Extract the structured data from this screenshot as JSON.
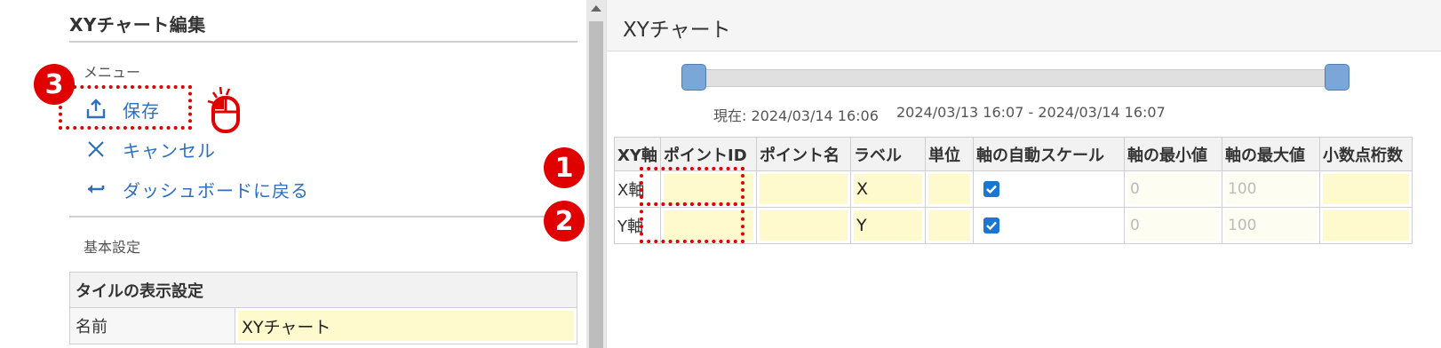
{
  "left": {
    "title": "XYチャート編集",
    "menu_label": "メニュー",
    "menu": [
      {
        "label": "保存",
        "icon": "upload-icon"
      },
      {
        "label": "キャンセル",
        "icon": "close-icon"
      },
      {
        "label": "ダッシュボードに戻る",
        "icon": "back-arrow-icon"
      }
    ],
    "basic_label": "基本設定",
    "tile_header": "タイルの表示設定",
    "tile_rows": [
      {
        "label": "名前",
        "value": "XYチャート"
      }
    ]
  },
  "right": {
    "title": "XYチャート",
    "current_time": "現在: 2024/03/14 16:06",
    "range": "2024/03/13 16:07 - 2024/03/14 16:07",
    "columns": [
      "XY軸",
      "ポイントID",
      "ポイント名",
      "ラベル",
      "単位",
      "軸の自動スケール",
      "軸の最小値",
      "軸の最大値",
      "小数点桁数"
    ],
    "rows": [
      {
        "axis": "X軸",
        "point_id": "",
        "point_name": "",
        "label": "X",
        "unit": "",
        "auto_scale": true,
        "min": "0",
        "max": "100",
        "decimals": ""
      },
      {
        "axis": "Y軸",
        "point_id": "",
        "point_name": "",
        "label": "Y",
        "unit": "",
        "auto_scale": true,
        "min": "0",
        "max": "100",
        "decimals": ""
      }
    ]
  },
  "annotations": {
    "badges": [
      "1",
      "2",
      "3"
    ],
    "color": "#e00000"
  },
  "colors": {
    "link": "#2e6fbf",
    "input_bg": "#fffacd",
    "checkbox": "#1976d2",
    "slider_handle": "#7aa7d8"
  }
}
